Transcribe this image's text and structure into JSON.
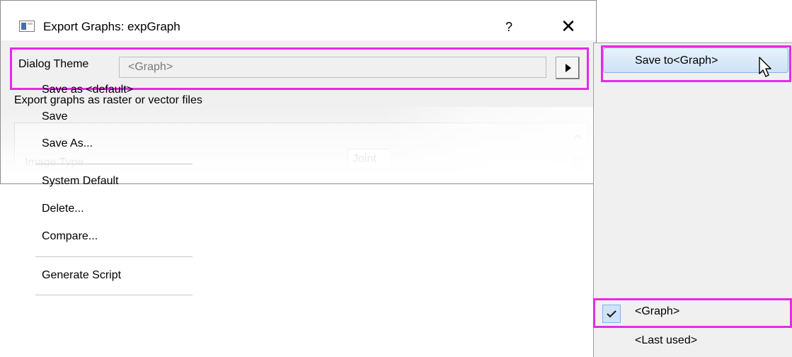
{
  "dialog": {
    "title": "Export Graphs: expGraph",
    "help_label": "?",
    "close_label": "✕",
    "theme_label": "Dialog Theme",
    "theme_value": "<Graph>",
    "description": "Export graphs as raster or vector files",
    "panel": {
      "row_label": "Image Type",
      "row_value": "Joint"
    }
  },
  "menu": {
    "items": [
      {
        "label": "Save to<Graph>"
      },
      {
        "label": "Save as <default>"
      },
      {
        "label": "Save"
      },
      {
        "label": "Save As..."
      },
      {
        "label": "System Default"
      },
      {
        "label": "Delete..."
      },
      {
        "label": "Compare..."
      },
      {
        "label": "Generate Script"
      },
      {
        "label": "<Graph>",
        "checked": true
      },
      {
        "label": "<Last used>"
      }
    ]
  },
  "colors": {
    "highlight_border": "#e62ae6",
    "menu_hover": "#cfe2f6",
    "menu_hover_border": "#7eb4ea"
  },
  "icons": [
    "dialog-app-icon",
    "help-icon",
    "close-icon",
    "play-arrow-icon",
    "scroll-up-icon",
    "checkmark-icon",
    "mouse-cursor-icon"
  ]
}
